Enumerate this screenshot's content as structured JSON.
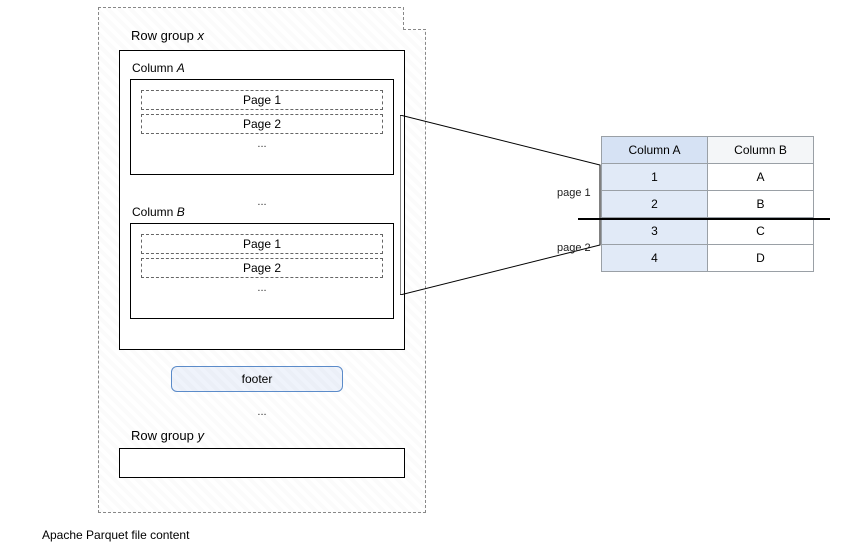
{
  "file": {
    "caption": "Apache Parquet file content",
    "row_group_x": {
      "label_prefix": "Row group ",
      "var": "x",
      "column_a": {
        "label_prefix": "Column ",
        "var": "A",
        "page1": "Page 1",
        "page2": "Page 2",
        "ellipsis": "..."
      },
      "between_ellipsis": "...",
      "column_b": {
        "label_prefix": "Column ",
        "var": "B",
        "page1": "Page 1",
        "page2": "Page 2",
        "ellipsis": "..."
      },
      "footer": "footer"
    },
    "file_ellipsis": "...",
    "row_group_y": {
      "label_prefix": "Row group ",
      "var": "y"
    }
  },
  "table": {
    "columns": {
      "a": "Column A",
      "b": "Column B"
    },
    "rows": [
      {
        "a": "1",
        "b": "A"
      },
      {
        "a": "2",
        "b": "B"
      },
      {
        "a": "3",
        "b": "C"
      },
      {
        "a": "4",
        "b": "D"
      }
    ],
    "page_labels": {
      "p1": "page 1",
      "p2": "page 2"
    }
  }
}
